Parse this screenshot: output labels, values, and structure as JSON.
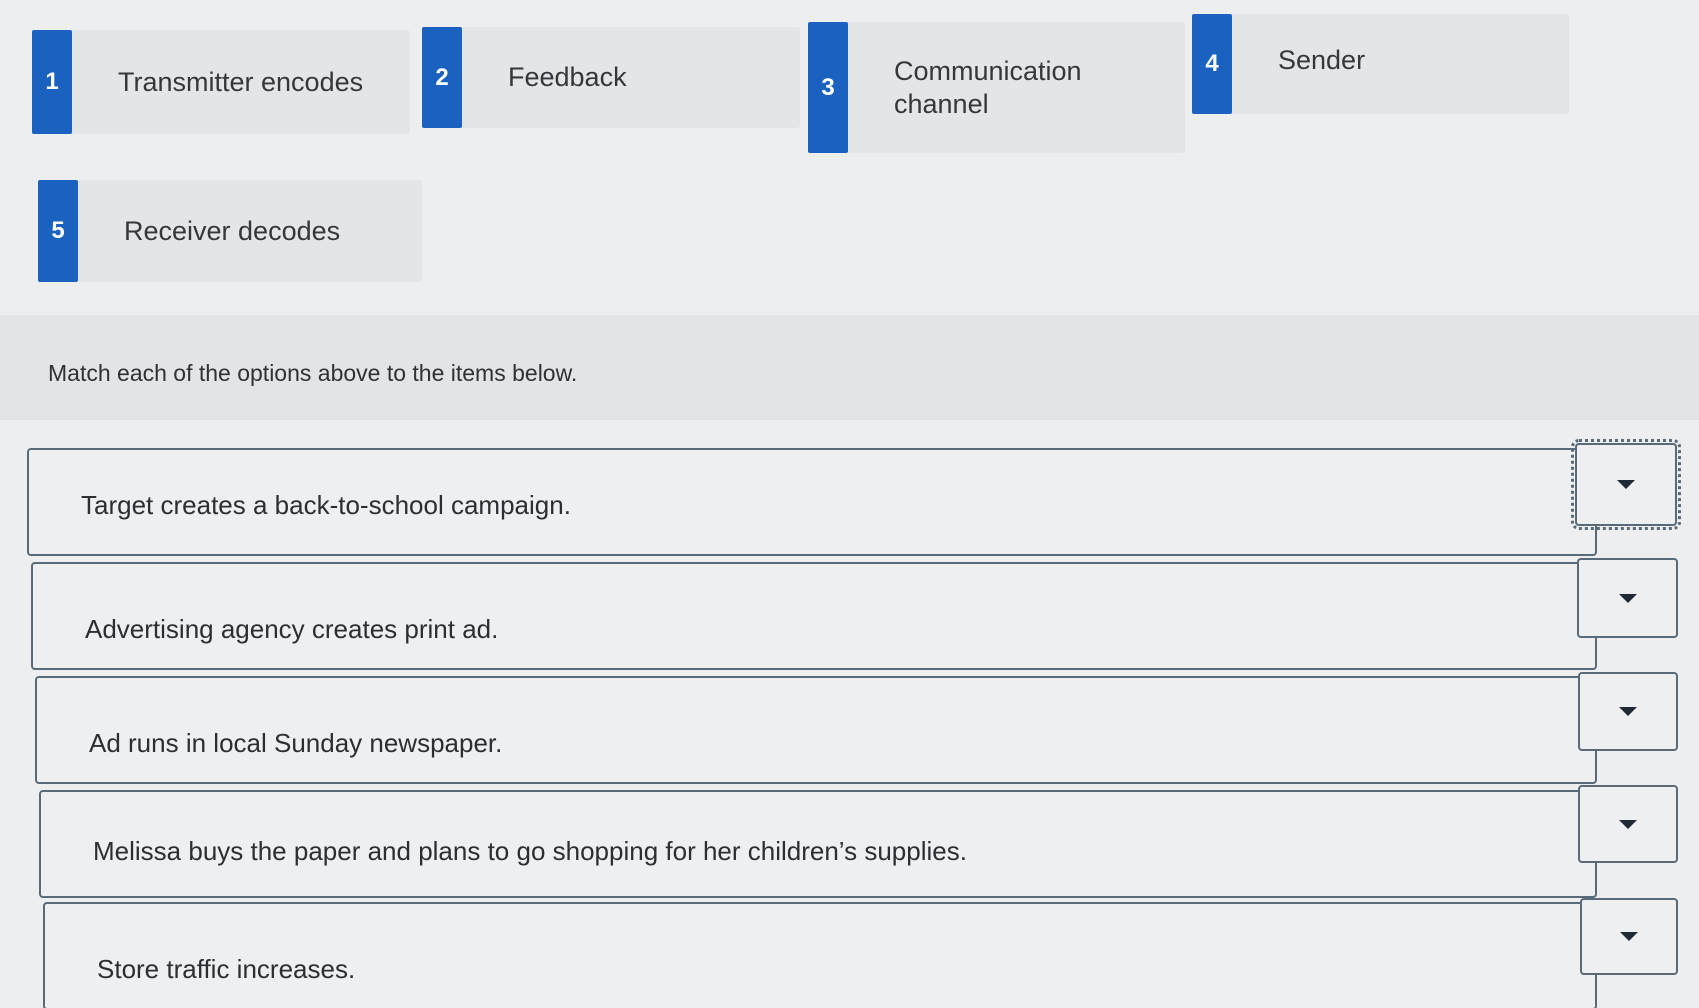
{
  "options": [
    {
      "number": "1",
      "label": "Transmitter encodes"
    },
    {
      "number": "2",
      "label": "Feedback"
    },
    {
      "number": "3",
      "label": "Communication channel"
    },
    {
      "number": "4",
      "label": "Sender"
    },
    {
      "number": "5",
      "label": "Receiver decodes"
    }
  ],
  "instruction": "Match each of the options above to the items below.",
  "items": [
    {
      "label": "Target creates a back-to-school campaign.",
      "selected": ""
    },
    {
      "label": "Advertising agency creates print ad.",
      "selected": ""
    },
    {
      "label": "Ad runs in local Sunday newspaper.",
      "selected": ""
    },
    {
      "label": "Melissa buys the paper and plans to go shopping for her children’s supplies.",
      "selected": ""
    },
    {
      "label": "Store traffic increases.",
      "selected": ""
    }
  ],
  "icons": {
    "dropdown": "chevron-down-icon"
  },
  "colors": {
    "accent": "#1a61c0",
    "border": "#5a6a78"
  }
}
